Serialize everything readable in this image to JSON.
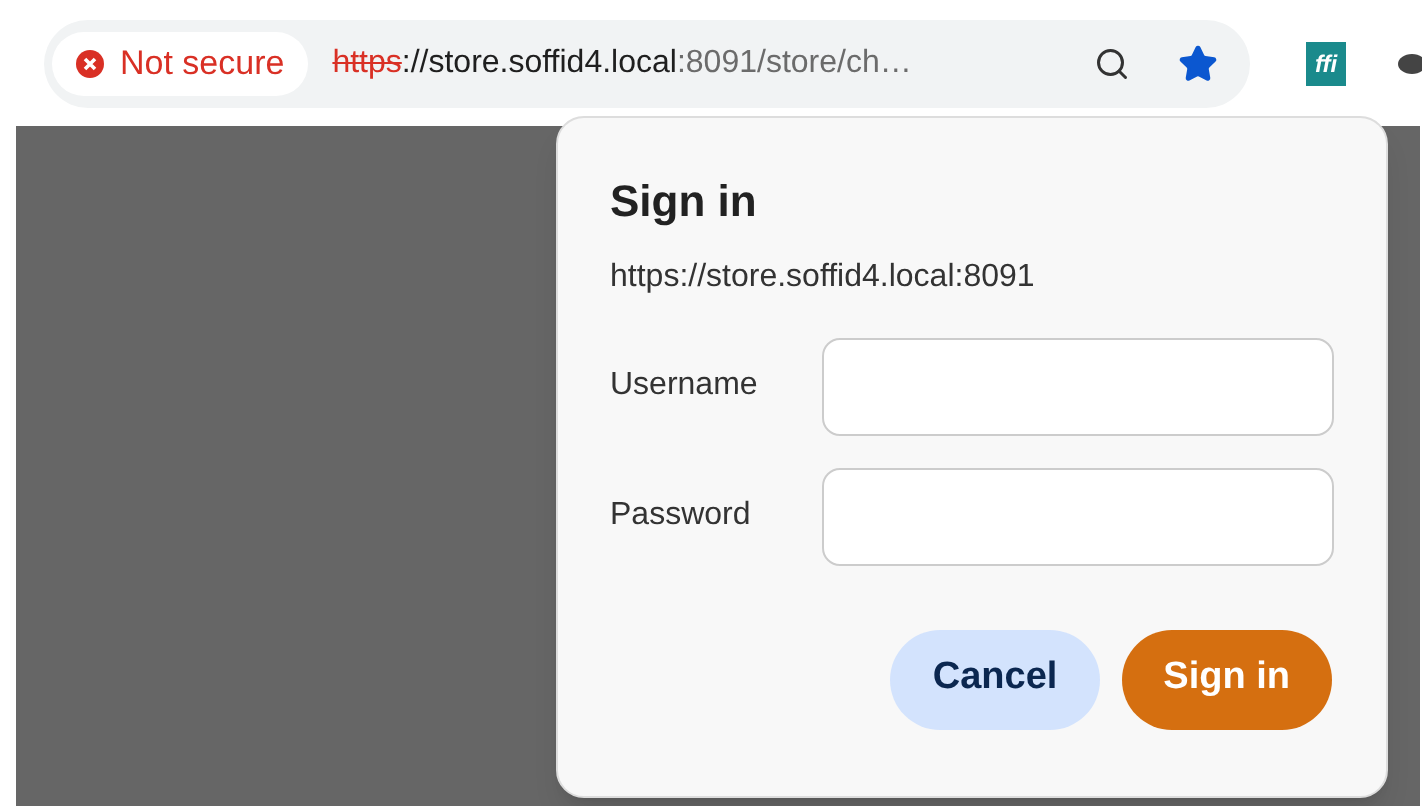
{
  "address_bar": {
    "security": {
      "label": "Not secure",
      "secure": false
    },
    "url": {
      "scheme": "https",
      "host": "://store.soffid4.local",
      "rest": ":8091/store/ch…"
    },
    "bookmarked": true
  },
  "extensions": [
    {
      "label": "ffi"
    }
  ],
  "dialog": {
    "title": "Sign in",
    "origin": "https://store.soffid4.local:8091",
    "fields": [
      {
        "label": "Username"
      },
      {
        "label": "Password"
      }
    ],
    "buttons": [
      {
        "label": "Cancel",
        "kind": "secondary"
      },
      {
        "label": "Sign in",
        "kind": "primary"
      }
    ]
  }
}
